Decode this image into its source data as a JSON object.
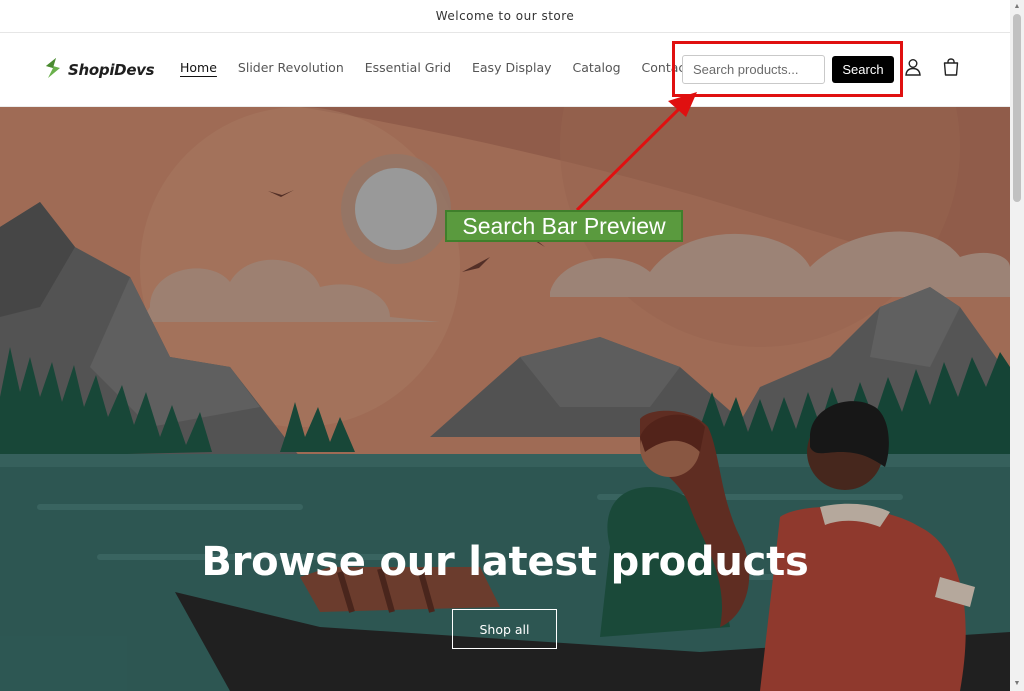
{
  "announcement": {
    "text": "Welcome to our store"
  },
  "header": {
    "logo_text": "ShopiDevs",
    "nav": [
      {
        "label": "Home",
        "active": true
      },
      {
        "label": "Slider Revolution",
        "active": false
      },
      {
        "label": "Essential Grid",
        "active": false
      },
      {
        "label": "Easy Display",
        "active": false
      },
      {
        "label": "Catalog",
        "active": false
      },
      {
        "label": "Contact",
        "active": false
      }
    ],
    "search": {
      "placeholder": "Search products...",
      "value": "",
      "button_label": "Search"
    },
    "icons": {
      "account": "user-icon",
      "cart": "cart-icon"
    }
  },
  "annotation": {
    "label": "Search Bar Preview",
    "highlight_color": "#e01010",
    "label_color": "#5a9a3e"
  },
  "hero": {
    "title": "Browse our latest products",
    "cta_label": "Shop all"
  },
  "colors": {
    "brand_green": "#6ab04c",
    "button_black": "#000000",
    "sky": "#c98b6e"
  }
}
